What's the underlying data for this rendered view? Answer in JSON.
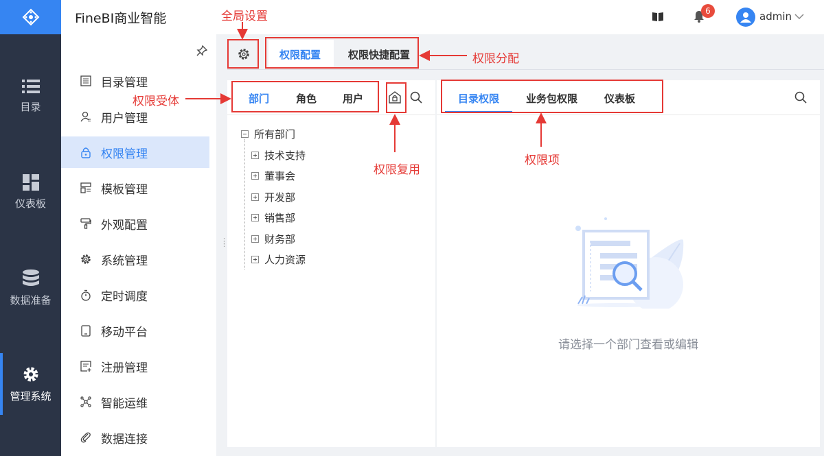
{
  "app": {
    "title": "FineBI商业智能",
    "username": "admin",
    "notification_count": "6"
  },
  "rail": [
    {
      "label": "目录",
      "icon": "list-icon"
    },
    {
      "label": "仪表板",
      "icon": "dashboard-icon"
    },
    {
      "label": "数据准备",
      "icon": "database-icon"
    },
    {
      "label": "管理系统",
      "icon": "gear-icon",
      "active": true
    }
  ],
  "menu": [
    {
      "label": "目录管理",
      "icon": "catalog-icon"
    },
    {
      "label": "用户管理",
      "icon": "user-manage-icon"
    },
    {
      "label": "权限管理",
      "icon": "lock-icon",
      "active": true
    },
    {
      "label": "模板管理",
      "icon": "template-icon"
    },
    {
      "label": "外观配置",
      "icon": "brush-icon"
    },
    {
      "label": "系统管理",
      "icon": "gear-icon"
    },
    {
      "label": "定时调度",
      "icon": "timer-icon"
    },
    {
      "label": "移动平台",
      "icon": "mobile-icon"
    },
    {
      "label": "注册管理",
      "icon": "register-icon"
    },
    {
      "label": "智能运维",
      "icon": "ops-icon"
    },
    {
      "label": "数据连接",
      "icon": "link-icon"
    }
  ],
  "top_tabs": [
    "权限配置",
    "权限快捷配置"
  ],
  "subject_tabs": [
    "部门",
    "角色",
    "用户"
  ],
  "item_tabs": [
    "目录权限",
    "业务包权限",
    "仪表板"
  ],
  "tree": {
    "root": "所有部门",
    "children": [
      "技术支持",
      "董事会",
      "开发部",
      "销售部",
      "财务部",
      "人力资源"
    ]
  },
  "empty_text": "请选择一个部门查看或编辑",
  "annotations": {
    "global_settings": "全局设置",
    "permission_assign": "权限分配",
    "permission_subject": "权限受体",
    "permission_reuse": "权限复用",
    "permission_item": "权限项"
  },
  "colors": {
    "accent": "#3685f2",
    "rail_bg": "#2b3446",
    "annotation": "#e53935"
  }
}
